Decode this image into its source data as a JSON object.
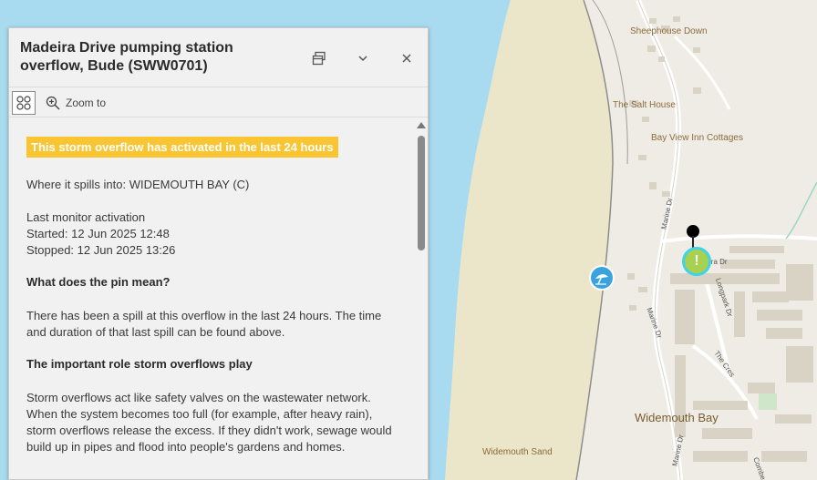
{
  "map": {
    "places": {
      "sheephouse_down": "Sheephouse Down",
      "salt_house": "The Salt House",
      "bay_view": "Bay View Inn Cottages",
      "widemouth_bay": "Widemouth Bay",
      "widemouth_sand": "Widemouth Sand"
    },
    "roads": {
      "marine_dr_north": "Marine Dr",
      "marine_dr_south": "Marine Dr",
      "marine_dr_bottom": "Marine Dr",
      "madeira_dr": "ira Dr",
      "longpark_dr": "Longpark Dr",
      "the_crescent": "The Cres",
      "combe_partial": "Combe"
    },
    "colors": {
      "sea": "#a8dbef",
      "beach": "#ebe6c9",
      "land": "#efece5",
      "pin_fill": "#a8d14f",
      "pin_ring": "#3fd2e8",
      "beach_icon": "#3aa3df"
    },
    "icons": {
      "beach": "beach-umbrella-icon",
      "pin": "warning-pin-icon"
    }
  },
  "popup": {
    "title": "Madeira Drive pumping station overflow, Bude (SWW0701)",
    "actions": {
      "dock": "dock-icon",
      "collapse": "chevron-down-icon",
      "close": "close-icon"
    },
    "toolbar": {
      "zoom_label": "Zoom to"
    },
    "badge": "This storm overflow has activated in the last 24 hours",
    "spills_into": "Where it spills into: WIDEMOUTH BAY (C)",
    "activation_heading": "Last monitor activation",
    "started": "Started: 12 Jun 2025 12:48",
    "stopped": "Stopped: 12 Jun 2025 13:26",
    "pin_heading": "What does the pin mean?",
    "pin_body": "There has been a spill at this overflow in the last 24 hours. The time and duration of that last spill can be found above.",
    "role_heading": "The important role storm overflows play",
    "role_body": "Storm overflows act like safety valves on the wastewater network. When the system becomes too full (for example, after heavy rain), storm overflows release the excess. If they didn't work, sewage would build up in pipes and flood into people's gardens and homes."
  }
}
